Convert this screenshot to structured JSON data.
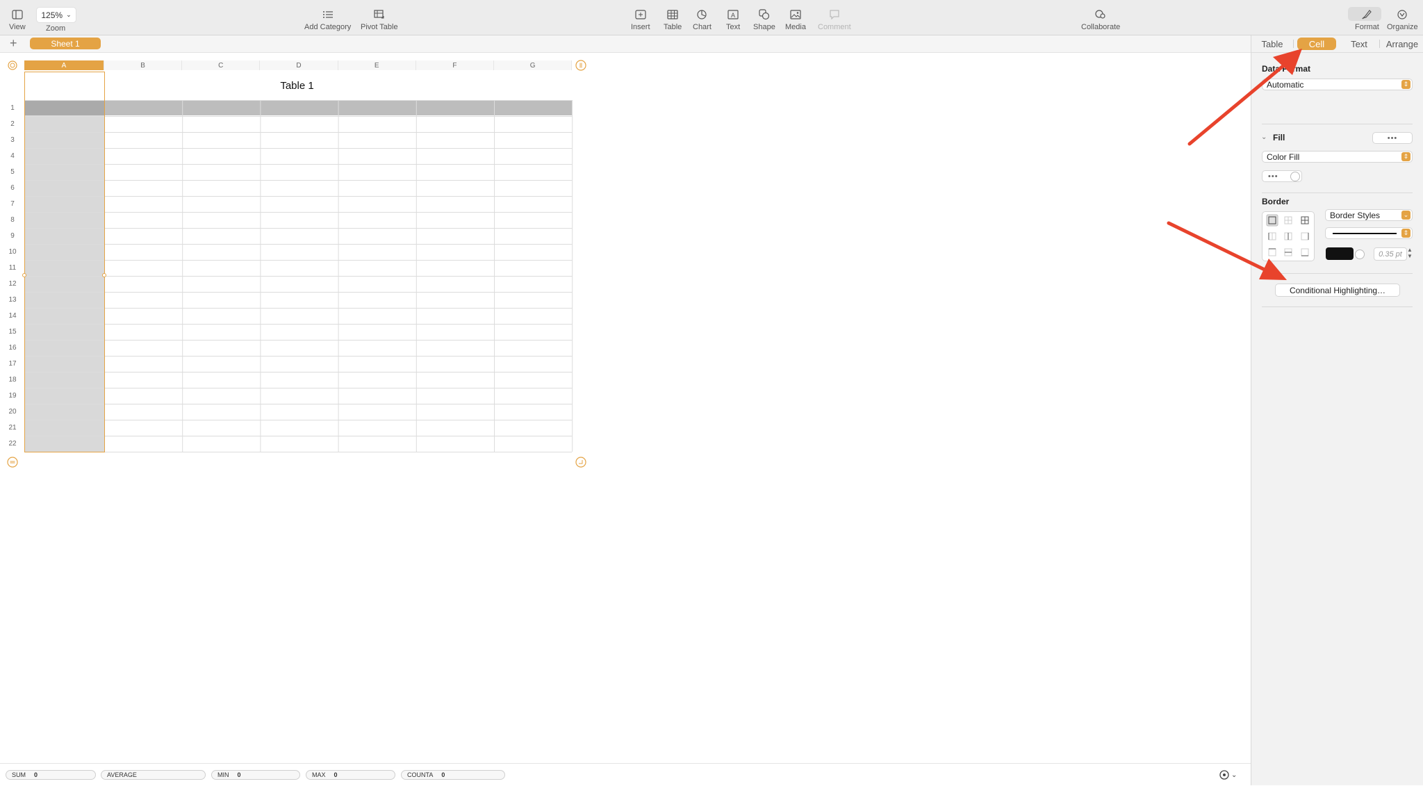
{
  "toolbar": {
    "view_label": "View",
    "zoom_value": "125%",
    "zoom_label": "Zoom",
    "add_category_label": "Add Category",
    "pivot_table_label": "Pivot Table",
    "insert_label": "Insert",
    "table_label": "Table",
    "chart_label": "Chart",
    "text_label": "Text",
    "shape_label": "Shape",
    "media_label": "Media",
    "comment_label": "Comment",
    "collaborate_label": "Collaborate",
    "format_label": "Format",
    "organize_label": "Organize"
  },
  "sheets": {
    "add_label": "+",
    "active_sheet": "Sheet 1"
  },
  "table": {
    "title": "Table 1",
    "columns": [
      "A",
      "B",
      "C",
      "D",
      "E",
      "F",
      "G"
    ],
    "rows": [
      "1",
      "2",
      "3",
      "4",
      "5",
      "6",
      "7",
      "8",
      "9",
      "10",
      "11",
      "12",
      "13",
      "14",
      "15",
      "16",
      "17",
      "18",
      "19",
      "20",
      "21",
      "22"
    ],
    "selected_column": "A"
  },
  "inspector": {
    "tabs": [
      "Table",
      "Cell",
      "Text",
      "Arrange"
    ],
    "active_tab": "Cell",
    "data_format_label": "Data Format",
    "data_format_value": "Automatic",
    "fill_label": "Fill",
    "fill_value": "Color Fill",
    "border_label": "Border",
    "border_styles_value": "Border Styles",
    "border_width": "0.35 pt",
    "conditional_button": "Conditional Highlighting…",
    "accent_color": "#e4a344",
    "arrow_color": "#e8432c"
  },
  "status": {
    "sum_label": "SUM",
    "sum_value": "0",
    "average_label": "AVERAGE",
    "min_label": "MIN",
    "min_value": "0",
    "max_label": "MAX",
    "max_value": "0",
    "counta_label": "COUNTA",
    "counta_value": "0"
  }
}
